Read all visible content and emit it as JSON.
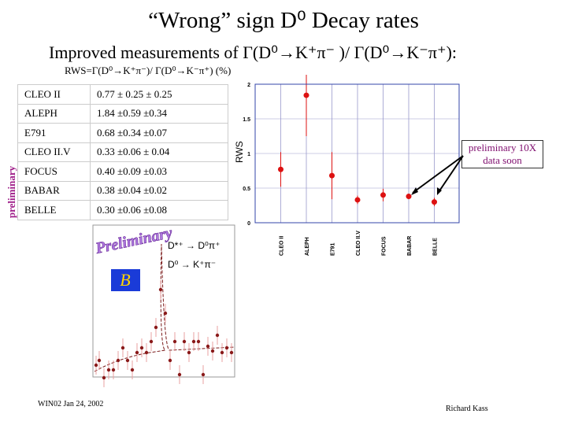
{
  "title": "“Wrong” sign D⁰ Decay rates",
  "subtitle": "Improved measurements of Γ(D⁰→K⁺π⁻ )/ Γ(D⁰→K⁻π⁺):",
  "rws_label": "RWS=Γ(D⁰→K⁺π⁻)/ Γ(D⁰→K⁻π⁺) (%)",
  "side_label": "preliminary",
  "table": [
    [
      "CLEO II",
      "0.77 ± 0.25 ± 0.25"
    ],
    [
      "ALEPH",
      "1.84 ±0.59 ±0.34"
    ],
    [
      "E791",
      "0.68 ±0.34 ±0.07"
    ],
    [
      "CLEO II.V",
      "0.33 ±0.06 ± 0.04"
    ],
    [
      "FOCUS",
      "0.40 ±0.09 ±0.03"
    ],
    [
      "BABAR",
      "0.38 ±0.04 ±0.02"
    ],
    [
      "BELLE",
      "0.30 ±0.06 ±0.08"
    ]
  ],
  "note": "preliminary 10X data soon",
  "lower_plot": {
    "watermark": "Preliminary",
    "decay1": "D*⁺ → D⁰π⁺",
    "decay2": "D⁰ → K⁺π⁻"
  },
  "footer_left": "WIN02 Jan 24, 2002",
  "footer_right": "Richard Kass",
  "chart_data": {
    "type": "scatter",
    "ylabel": "RWS",
    "categories": [
      "CLEO II",
      "ALEPH",
      "E791",
      "CLEO II.V",
      "FOCUS",
      "BABAR",
      "BELLE"
    ],
    "values": [
      0.77,
      1.84,
      0.68,
      0.33,
      0.4,
      0.38,
      0.3
    ],
    "errors": [
      0.25,
      0.59,
      0.34,
      0.06,
      0.09,
      0.04,
      0.06
    ],
    "ylim": [
      0,
      2
    ],
    "yticks": [
      "0",
      "0.5",
      "1",
      "1.5",
      "2"
    ],
    "grid": true,
    "point_color": "#dd1111",
    "grid_color": "#9999cc"
  }
}
